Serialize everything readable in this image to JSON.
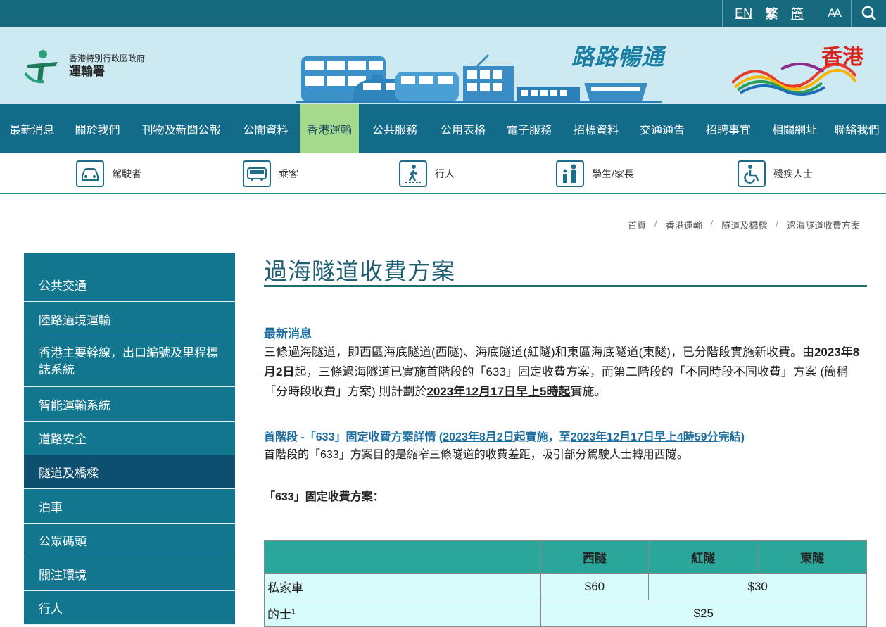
{
  "topbar": {
    "lang_en": "EN",
    "lang_tc": "繁",
    "lang_sc": "簡",
    "font_size": "AA"
  },
  "header": {
    "gov_name": "香港特別行政區政府",
    "dept_name": "運輸署",
    "slogan": "路路暢通",
    "brand": "香港"
  },
  "mainnav": [
    "最新消息",
    "關於我們",
    "刊物及新聞公報",
    "公開資料",
    "香港運輸",
    "公共服務",
    "公用表格",
    "電子服務",
    "招標資料",
    "交通通告",
    "招聘事宜",
    "相關網址",
    "聯絡我們"
  ],
  "audiences": {
    "driver": "駕駛者",
    "passenger": "乘客",
    "pedestrian": "行人",
    "students": "學生/家長",
    "disabled": "殘疾人士"
  },
  "breadcrumb": [
    "首頁",
    "香港運輸",
    "隧道及橋樑",
    "過海隧道收費方案"
  ],
  "sidebar": [
    "公共交通",
    "陸路過境運輸",
    "香港主要幹線，出口編號及里程標誌系統",
    "智能運輸系統",
    "道路安全",
    "隧道及橋樑",
    "泊車",
    "公眾碼頭",
    "關注環境",
    "行人"
  ],
  "page": {
    "title": "過海隧道收費方案",
    "news_heading": "最新消息",
    "news_text_1": "三條過海隧道，即西區海底隧道(西隧)、海底隧道(紅隧)和東區海底隧道(東隧)，已分階段實施新收費。由",
    "news_date_1": "2023年8月2日",
    "news_text_2": "起，三條過海隧道已實施首階段的「633」固定收費方案，而第二階段的「不同時段不同收費」方案 (簡稱「分時段收費」方案) 則計劃於",
    "news_date_2": "2023年12月17日早上5時起",
    "news_text_3": "實施。",
    "stage1_a": "首階段 -「633」固定收費方案詳情 (",
    "stage1_date1": "2023年8月2日",
    "stage1_b": "起實施，至",
    "stage1_date2": "2023年12月17日早上4時59分",
    "stage1_c": "完結)",
    "stage1_desc": "首階段的「633」方案目的是縮窄三條隧道的收費差距，吸引部分駕駛人士轉用西隧。",
    "scheme_label": "「633」固定收費方案："
  },
  "table": {
    "headers": [
      "",
      "西隧",
      "紅隧",
      "東隧"
    ],
    "rows": [
      {
        "name": "私家車",
        "western": "$60",
        "others": "$30"
      },
      {
        "name": "的士",
        "sup": "1",
        "all": "$25"
      }
    ]
  },
  "colors": {
    "topbar": "#17697e",
    "banner": "#cdeaf3",
    "nav": "#136b8a",
    "nav_active": "#a4d98e",
    "sidebar": "#12768e",
    "sidebar_active": "#0e4f70",
    "table_header": "#2aa79a",
    "table_cell": "#d8fbfb"
  }
}
